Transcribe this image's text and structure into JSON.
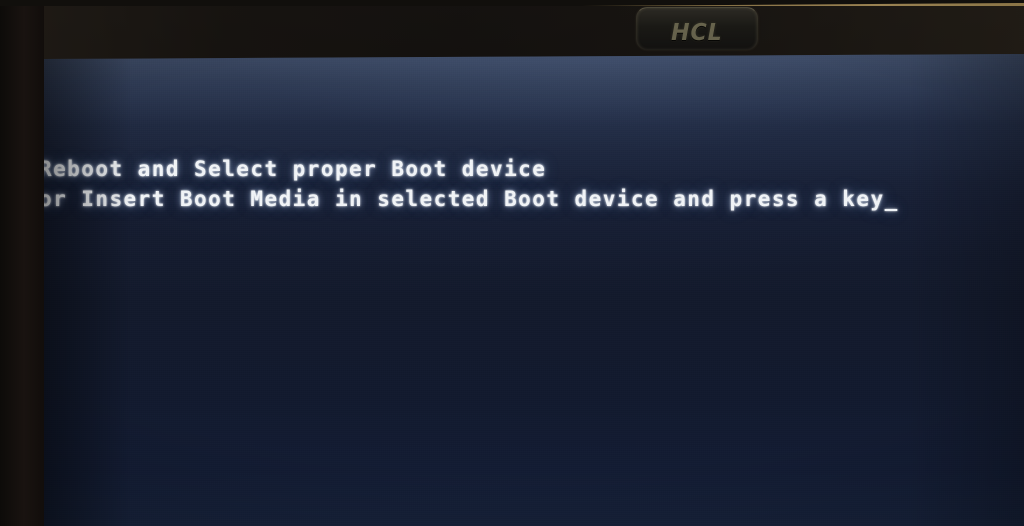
{
  "photo": {
    "subject": "monitor-displaying-bios-boot-error",
    "wall_color": "#8a7448",
    "bezel_color": "#110f0c"
  },
  "monitor": {
    "brand_badge": {
      "name": "hcl-logo",
      "label": "HCL"
    }
  },
  "screen": {
    "background_top_color": "#2b3448",
    "background_bottom_color": "#162139",
    "text_color": "#f2f5f8",
    "bios_message": {
      "line1": "Reboot and Select proper Boot device",
      "line2": "or Insert Boot Media in selected Boot device and press a key",
      "cursor": "_"
    }
  }
}
